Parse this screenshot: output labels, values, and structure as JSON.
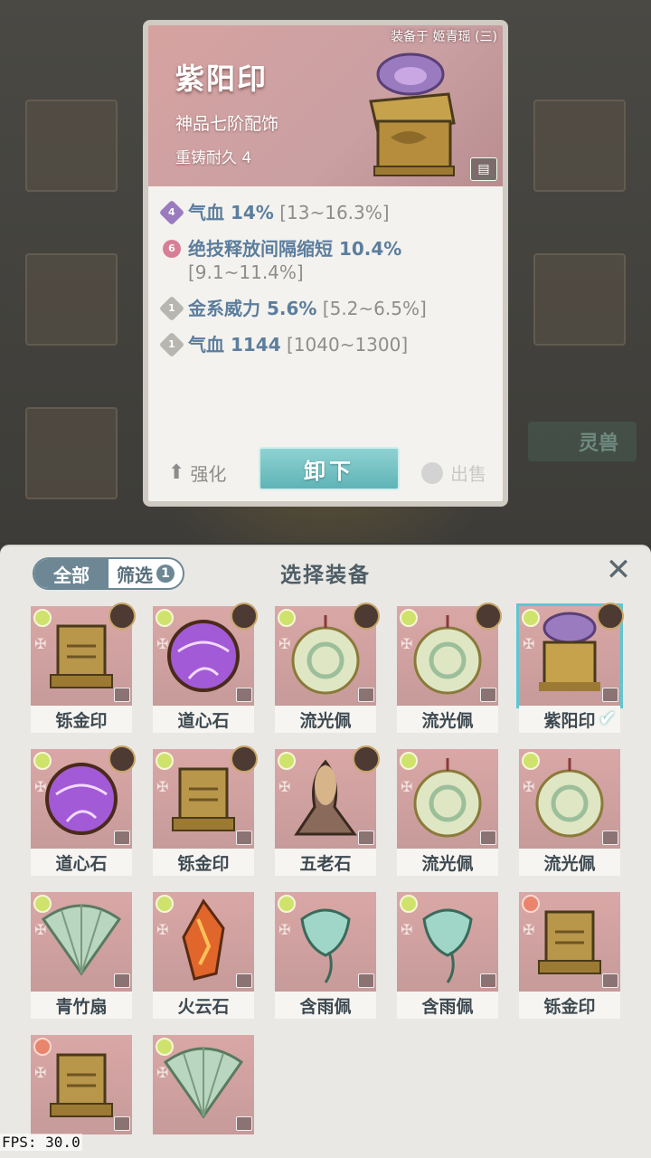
{
  "detail": {
    "equipped_on": "装备于 姬青瑶 (三)",
    "name": "紫阳印",
    "grade": "神品七阶配饰",
    "durability": "重铸耐久 4",
    "stats": [
      {
        "badge": "4",
        "badge_style": "purple",
        "main": "气血 14%",
        "range": "[13~16.3%]"
      },
      {
        "badge": "6",
        "badge_style": "pink",
        "main": "绝技释放间隔缩短 10.4%",
        "range": "[9.1~11.4%]"
      },
      {
        "badge": "1",
        "badge_style": "grey",
        "main": "金系威力 5.6%",
        "range": "[5.2~6.5%]"
      },
      {
        "badge": "1",
        "badge_style": "grey",
        "main": "气血 1144",
        "range": "[1040~1300]"
      }
    ],
    "enhance_label": "强化",
    "unequip_label": "卸下",
    "sell_label": "出售"
  },
  "background": {
    "tab_label": "灵兽"
  },
  "panel": {
    "filter_all": "全部",
    "filter_label": "筛选",
    "filter_count": "1",
    "title": "选择装备",
    "close_icon": "close-icon"
  },
  "items": [
    {
      "label": "铄金印",
      "quality": "green",
      "avatar": true,
      "selected": false,
      "art": "seal"
    },
    {
      "label": "道心石",
      "quality": "green",
      "avatar": true,
      "selected": false,
      "art": "orb"
    },
    {
      "label": "流光佩",
      "quality": "green",
      "avatar": true,
      "selected": false,
      "art": "jade"
    },
    {
      "label": "流光佩",
      "quality": "green",
      "avatar": true,
      "selected": false,
      "art": "jade"
    },
    {
      "label": "紫阳印",
      "quality": "green",
      "avatar": true,
      "selected": true,
      "art": "seal-purple"
    },
    {
      "label": "道心石",
      "quality": "green",
      "avatar": true,
      "selected": false,
      "art": "orb"
    },
    {
      "label": "铄金印",
      "quality": "green",
      "avatar": true,
      "selected": false,
      "art": "seal"
    },
    {
      "label": "五老石",
      "quality": "green",
      "avatar": true,
      "selected": false,
      "art": "rock"
    },
    {
      "label": "流光佩",
      "quality": "green",
      "avatar": false,
      "selected": false,
      "art": "jade"
    },
    {
      "label": "流光佩",
      "quality": "green",
      "avatar": false,
      "selected": false,
      "art": "jade"
    },
    {
      "label": "青竹扇",
      "quality": "green",
      "avatar": false,
      "selected": false,
      "art": "fan"
    },
    {
      "label": "火云石",
      "quality": "green",
      "avatar": false,
      "selected": false,
      "art": "fire"
    },
    {
      "label": "含雨佩",
      "quality": "green",
      "avatar": false,
      "selected": false,
      "art": "pendant"
    },
    {
      "label": "含雨佩",
      "quality": "green",
      "avatar": false,
      "selected": false,
      "art": "pendant"
    },
    {
      "label": "铄金印",
      "quality": "red",
      "avatar": false,
      "selected": false,
      "art": "seal"
    },
    {
      "label": "",
      "quality": "red",
      "avatar": false,
      "selected": false,
      "art": "seal"
    },
    {
      "label": "",
      "quality": "green",
      "avatar": false,
      "selected": false,
      "art": "fan"
    }
  ],
  "fps": "FPS: 30.0"
}
